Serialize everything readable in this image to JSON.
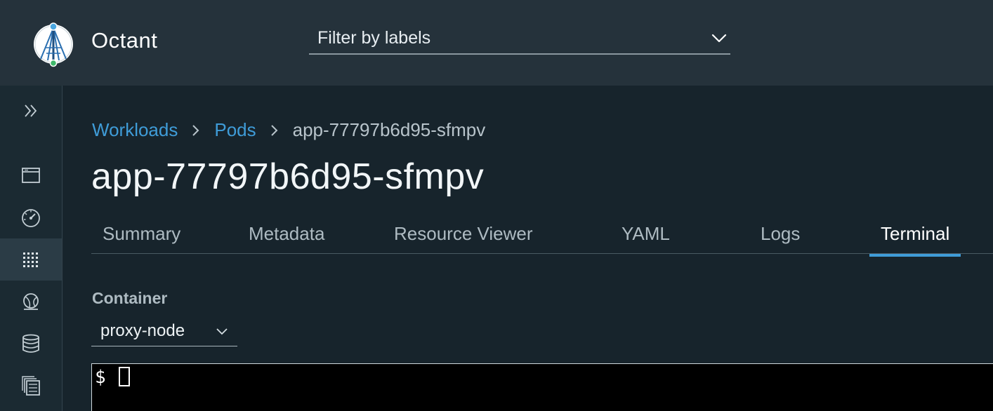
{
  "header": {
    "app_name": "Octant",
    "filter": {
      "placeholder": "Filter by labels"
    }
  },
  "sidebar": {
    "items": [
      {
        "icon": "double-chevron-right-icon"
      },
      {
        "icon": "browser-window-icon"
      },
      {
        "icon": "dashboard-gauge-icon"
      },
      {
        "icon": "grid-dots-icon",
        "active": true
      },
      {
        "icon": "network-globe-icon"
      },
      {
        "icon": "database-icon"
      },
      {
        "icon": "copy-documents-icon"
      }
    ]
  },
  "breadcrumb": {
    "items": [
      "Workloads",
      "Pods",
      "app-77797b6d95-sfmpv"
    ]
  },
  "page": {
    "title": "app-77797b6d95-sfmpv"
  },
  "tabs": [
    {
      "label": "Summary"
    },
    {
      "label": "Metadata"
    },
    {
      "label": "Resource Viewer"
    },
    {
      "label": "YAML"
    },
    {
      "label": "Logs"
    },
    {
      "label": "Terminal",
      "active": true
    }
  ],
  "container": {
    "label": "Container",
    "selected": "proxy-node"
  },
  "terminal": {
    "prompt": "$"
  },
  "colors": {
    "accent": "#3f9cd8",
    "header_bg": "#25323b",
    "main_bg": "#17242c",
    "terminal_bg": "#000000"
  }
}
